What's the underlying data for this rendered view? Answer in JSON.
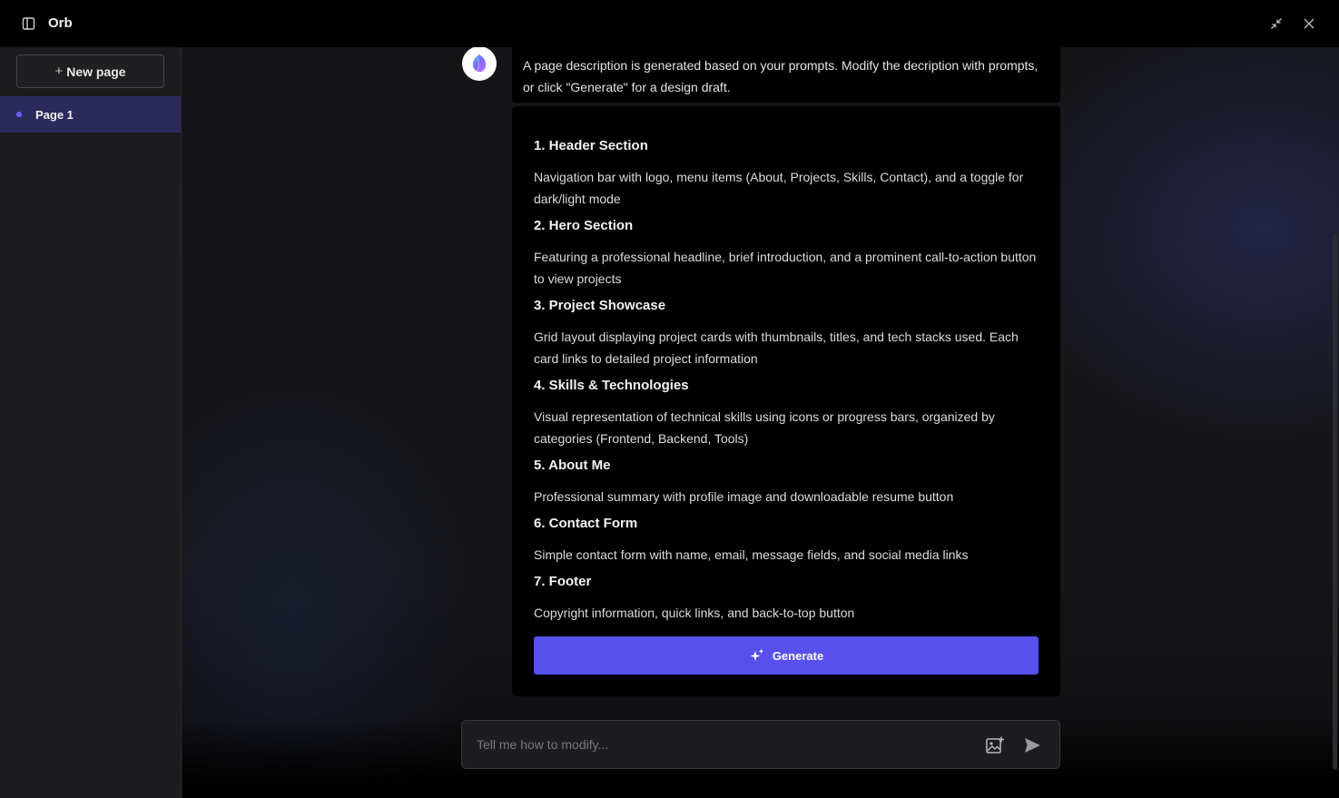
{
  "app": {
    "title": "Orb"
  },
  "sidebar": {
    "new_page_label": "New page",
    "pages": [
      {
        "label": "Page 1",
        "selected": true
      }
    ]
  },
  "chat": {
    "assistant_message": "A page description is generated based on your prompts. Modify the decription with prompts, or click \"Generate\" for a design draft.",
    "sections": [
      {
        "title": "1. Header Section",
        "body": "Navigation bar with logo, menu items (About, Projects, Skills, Contact), and a toggle for dark/light mode"
      },
      {
        "title": "2. Hero Section",
        "body": "Featuring a professional headline, brief introduction, and a prominent call-to-action button to view projects"
      },
      {
        "title": "3. Project Showcase",
        "body": "Grid layout displaying project cards with thumbnails, titles, and tech stacks used. Each card links to detailed project information"
      },
      {
        "title": "4. Skills & Technologies",
        "body": "Visual representation of technical skills using icons or progress bars, organized by categories (Frontend, Backend, Tools)"
      },
      {
        "title": "5. About Me",
        "body": "Professional summary with profile image and downloadable resume button"
      },
      {
        "title": "6. Contact Form",
        "body": "Simple contact form with name, email, message fields, and social media links"
      },
      {
        "title": "7. Footer",
        "body": "Copyright information, quick links, and back-to-top button"
      }
    ],
    "generate_label": "Generate"
  },
  "input": {
    "placeholder": "Tell me how to modify...",
    "value": ""
  },
  "colors": {
    "accent": "#5850ec",
    "selected_page_bg": "#2c2a5c",
    "titlebar_bg": "#000000",
    "sidebar_bg": "#1c1c1e"
  },
  "icons": {
    "sidebar_toggle": "sidebar-toggle-icon",
    "minimize": "minimize-icon",
    "close": "close-icon",
    "logo": "orb-logo-icon",
    "sparkle": "sparkle-icon",
    "image_upload": "image-upload-icon",
    "send": "send-icon"
  }
}
